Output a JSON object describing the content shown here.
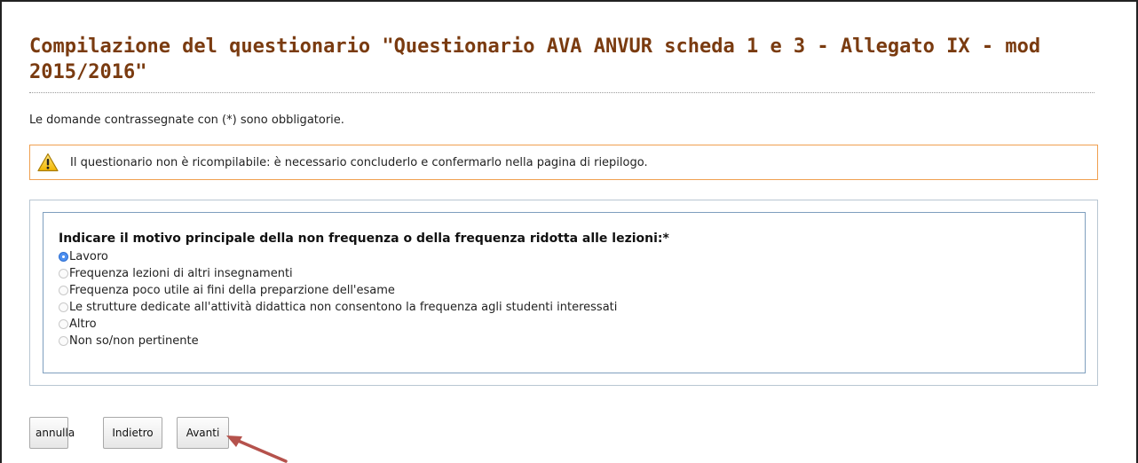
{
  "page": {
    "title": "Compilazione del questionario \"Questionario AVA ANVUR scheda 1 e 3 - Allegato IX - mod 2015/2016\"",
    "required_note": "Le domande contrassegnate con (*) sono obbligatorie."
  },
  "warning": {
    "icon": "warning-triangle-icon",
    "text": "Il questionario non è ricompilabile: è necessario concluderlo e confermarlo nella pagina di riepilogo.",
    "border_color": "#f0a050"
  },
  "question": {
    "label": "Indicare il motivo principale della non frequenza o della frequenza ridotta alle lezioni:*",
    "selected": "Lavoro",
    "options": [
      "Lavoro",
      "Frequenza lezioni di altri insegnamenti",
      "Frequenza poco utile ai fini della preparzione dell'esame",
      "Le strutture dedicate all'attività didattica non consentono la frequenza agli studenti interessati",
      "Altro",
      "Non so/non pertinente"
    ]
  },
  "buttons": {
    "cancel": "annulla",
    "back": "Indietro",
    "next": "Avanti"
  },
  "colors": {
    "title": "#7a3b10",
    "box_border": "#7f9fbe",
    "radio_selected": "#4d8ff0",
    "annotation_arrow": "#b5524c"
  }
}
